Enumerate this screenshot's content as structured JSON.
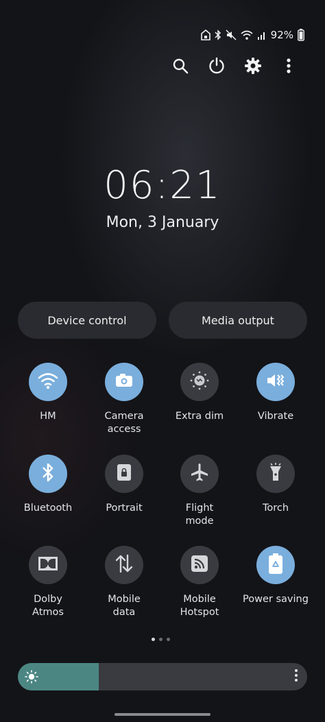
{
  "status_bar": {
    "icons": [
      "home-lock-icon",
      "bluetooth-icon",
      "mute-icon",
      "wifi-icon",
      "signal-icon"
    ],
    "battery": "92%"
  },
  "toolbar": {
    "actions": [
      "search-icon",
      "power-icon",
      "settings-gear-icon",
      "more-vertical-icon"
    ]
  },
  "clock": {
    "time": "06:21",
    "date": "Mon, 3 January"
  },
  "buttons": {
    "device_control": "Device control",
    "media_output": "Media output"
  },
  "tiles": [
    {
      "label": "HM",
      "icon": "wifi-icon",
      "active": true
    },
    {
      "label": "Camera\naccess",
      "icon": "camera-icon",
      "active": true
    },
    {
      "label": "Extra dim",
      "icon": "extra-dim-icon",
      "active": false
    },
    {
      "label": "Vibrate",
      "icon": "vibrate-icon",
      "active": true
    },
    {
      "label": "Bluetooth",
      "icon": "bluetooth-icon",
      "active": true
    },
    {
      "label": "Portrait",
      "icon": "portrait-lock-icon",
      "active": false
    },
    {
      "label": "Flight\nmode",
      "icon": "airplane-icon",
      "active": false
    },
    {
      "label": "Torch",
      "icon": "flashlight-icon",
      "active": false
    },
    {
      "label": "Dolby\nAtmos",
      "icon": "dolby-icon",
      "active": false
    },
    {
      "label": "Mobile\ndata",
      "icon": "mobile-data-icon",
      "active": false
    },
    {
      "label": "Mobile\nHotspot",
      "icon": "hotspot-icon",
      "active": false
    },
    {
      "label": "Power saving",
      "icon": "battery-saver-icon",
      "active": true
    }
  ],
  "pager": {
    "pages": 3,
    "current": 1
  },
  "brightness": {
    "level": 0.28
  },
  "colors": {
    "accent_on": "#7aaedc",
    "tile_off": "#3a3b40",
    "brightness_fill": "#4c8683"
  }
}
